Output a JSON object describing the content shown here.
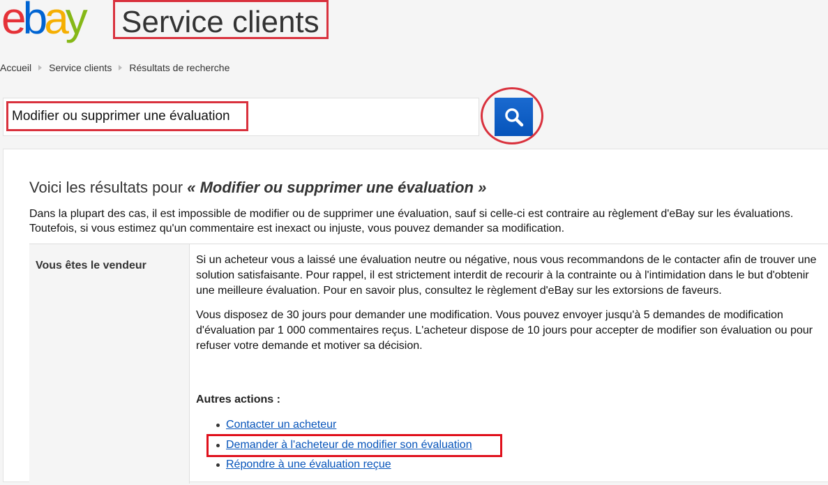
{
  "header": {
    "logo_letters": [
      {
        "ch": "e",
        "color": "#e53238"
      },
      {
        "ch": "b",
        "color": "#0064d2"
      },
      {
        "ch": "a",
        "color": "#f5af02"
      },
      {
        "ch": "y",
        "color": "#86b817"
      }
    ],
    "title": "Service clients"
  },
  "breadcrumb": [
    "Accueil",
    "Service clients",
    "Résultats de recherche"
  ],
  "search": {
    "value": "Modifier ou supprimer une évaluation",
    "button_icon": "search-icon"
  },
  "results": {
    "title_prefix": "Voici les résultats pour ",
    "title_query": "« Modifier ou supprimer une évaluation »",
    "intro": "Dans la plupart des cas, il est impossible de modifier ou de supprimer une évaluation, sauf si celle-ci est contraire au règlement d'eBay sur les évaluations. Toutefois, si vous estimez qu'un commentaire est inexact ou injuste, vous pouvez demander sa modification."
  },
  "table": {
    "row_label": "Vous êtes le vendeur",
    "paragraphs": [
      "Si un acheteur vous a laissé une évaluation neutre ou négative, nous vous recommandons de le contacter afin de trouver une solution satisfaisante. Pour rappel, il est strictement interdit de recourir à la contrainte ou à l'intimidation dans le but d'obtenir une meilleure évaluation. Pour en savoir plus, consultez le règlement d'eBay sur les extorsions de faveurs.",
      "Vous disposez de 30 jours pour demander une modification. Vous pouvez envoyer jusqu'à 5 demandes de modification d'évaluation par 1 000 commentaires reçus. L'acheteur dispose de 10 jours pour accepter de modifier son évaluation ou pour refuser votre demande et motiver sa décision."
    ],
    "actions_title": "Autres actions :",
    "actions": [
      "Contacter un acheteur",
      "Demander à l'acheteur de modifier son évaluation",
      "Répondre à une évaluation reçue"
    ]
  },
  "colors": {
    "annotation_red": "#d9313d",
    "link_blue": "#0654ba",
    "search_button": "#0654ba"
  }
}
